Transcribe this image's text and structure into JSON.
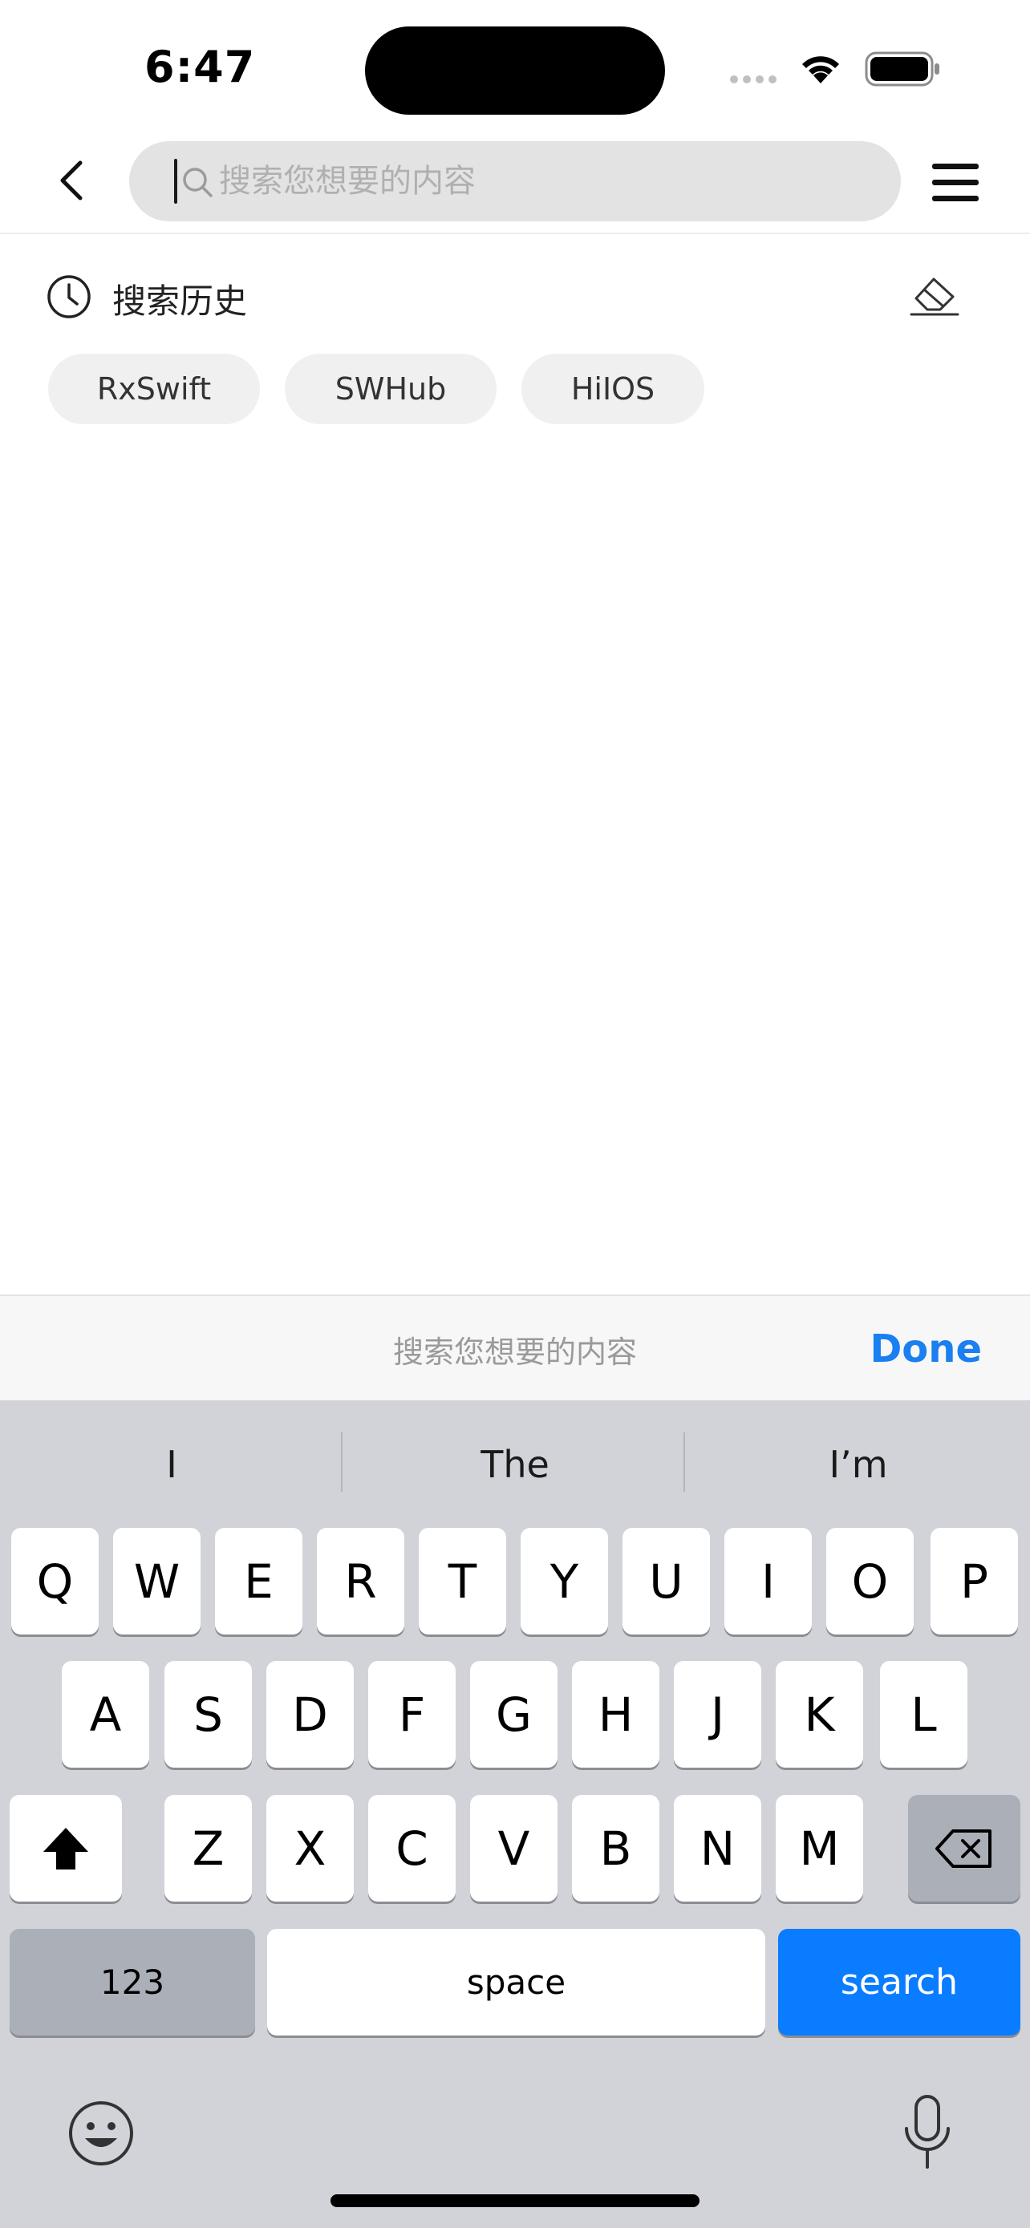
{
  "status_bar": {
    "time": "6:47"
  },
  "nav": {
    "search_placeholder": "搜索您想要的内容",
    "search_value": ""
  },
  "history": {
    "title": "搜索历史",
    "chips": [
      "RxSwift",
      "SWHub",
      "HiIOS"
    ]
  },
  "accessory": {
    "placeholder": "搜索您想要的内容",
    "done_label": "Done"
  },
  "keyboard": {
    "predictions": [
      "I",
      "The",
      "I’m"
    ],
    "row1": [
      "Q",
      "W",
      "E",
      "R",
      "T",
      "Y",
      "U",
      "I",
      "O",
      "P"
    ],
    "row2": [
      "A",
      "S",
      "D",
      "F",
      "G",
      "H",
      "J",
      "K",
      "L"
    ],
    "row3": [
      "Z",
      "X",
      "C",
      "V",
      "B",
      "N",
      "M"
    ],
    "numbers_label": "123",
    "space_label": "space",
    "return_label": "search",
    "return_color": "#0a7cff"
  },
  "icons": {
    "back": "chevron-left-icon",
    "search": "magnifier-icon",
    "menu": "hamburger-menu-icon",
    "history": "clock-icon",
    "clear": "eraser-icon",
    "shift": "shift-arrow-icon",
    "delete": "backspace-icon",
    "emoji": "emoji-icon",
    "dictation": "microphone-icon"
  }
}
